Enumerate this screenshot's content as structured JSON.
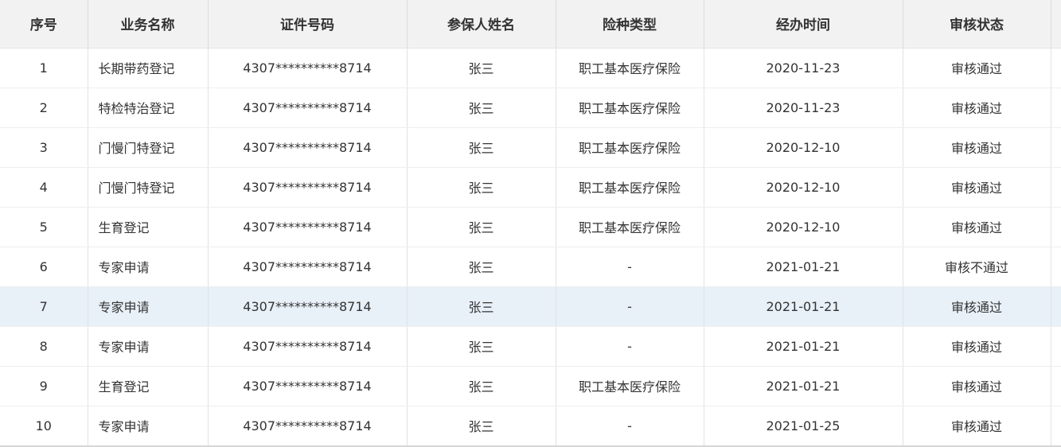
{
  "table": {
    "columns": [
      "序号",
      "业务名称",
      "证件号码",
      "参保人姓名",
      "险种类型",
      "经办时间",
      "审核状态"
    ],
    "rows": [
      {
        "seq": "1",
        "biz": "长期带药登记",
        "id": "4307**********8714",
        "name": "张三",
        "type": "职工基本医疗保险",
        "date": "2020-11-23",
        "status": "审核通过"
      },
      {
        "seq": "2",
        "biz": "特检特治登记",
        "id": "4307**********8714",
        "name": "张三",
        "type": "职工基本医疗保险",
        "date": "2020-11-23",
        "status": "审核通过"
      },
      {
        "seq": "3",
        "biz": "门慢门特登记",
        "id": "4307**********8714",
        "name": "张三",
        "type": "职工基本医疗保险",
        "date": "2020-12-10",
        "status": "审核通过"
      },
      {
        "seq": "4",
        "biz": "门慢门特登记",
        "id": "4307**********8714",
        "name": "张三",
        "type": "职工基本医疗保险",
        "date": "2020-12-10",
        "status": "审核通过"
      },
      {
        "seq": "5",
        "biz": "生育登记",
        "id": "4307**********8714",
        "name": "张三",
        "type": "职工基本医疗保险",
        "date": "2020-12-10",
        "status": "审核通过"
      },
      {
        "seq": "6",
        "biz": "专家申请",
        "id": "4307**********8714",
        "name": "张三",
        "type": "-",
        "date": "2021-01-21",
        "status": "审核不通过"
      },
      {
        "seq": "7",
        "biz": "专家申请",
        "id": "4307**********8714",
        "name": "张三",
        "type": "-",
        "date": "2021-01-21",
        "status": "审核通过"
      },
      {
        "seq": "8",
        "biz": "专家申请",
        "id": "4307**********8714",
        "name": "张三",
        "type": "-",
        "date": "2021-01-21",
        "status": "审核通过"
      },
      {
        "seq": "9",
        "biz": "生育登记",
        "id": "4307**********8714",
        "name": "张三",
        "type": "职工基本医疗保险",
        "date": "2021-01-21",
        "status": "审核通过"
      },
      {
        "seq": "10",
        "biz": "专家申请",
        "id": "4307**********8714",
        "name": "张三",
        "type": "-",
        "date": "2021-01-25",
        "status": "审核通过"
      }
    ],
    "highlighted_row": 7
  },
  "colors": {
    "header_bg": "#f2f2f2",
    "row_highlight": "#e8f0f8",
    "text": "#333333",
    "grid": "#e2e2e2"
  }
}
